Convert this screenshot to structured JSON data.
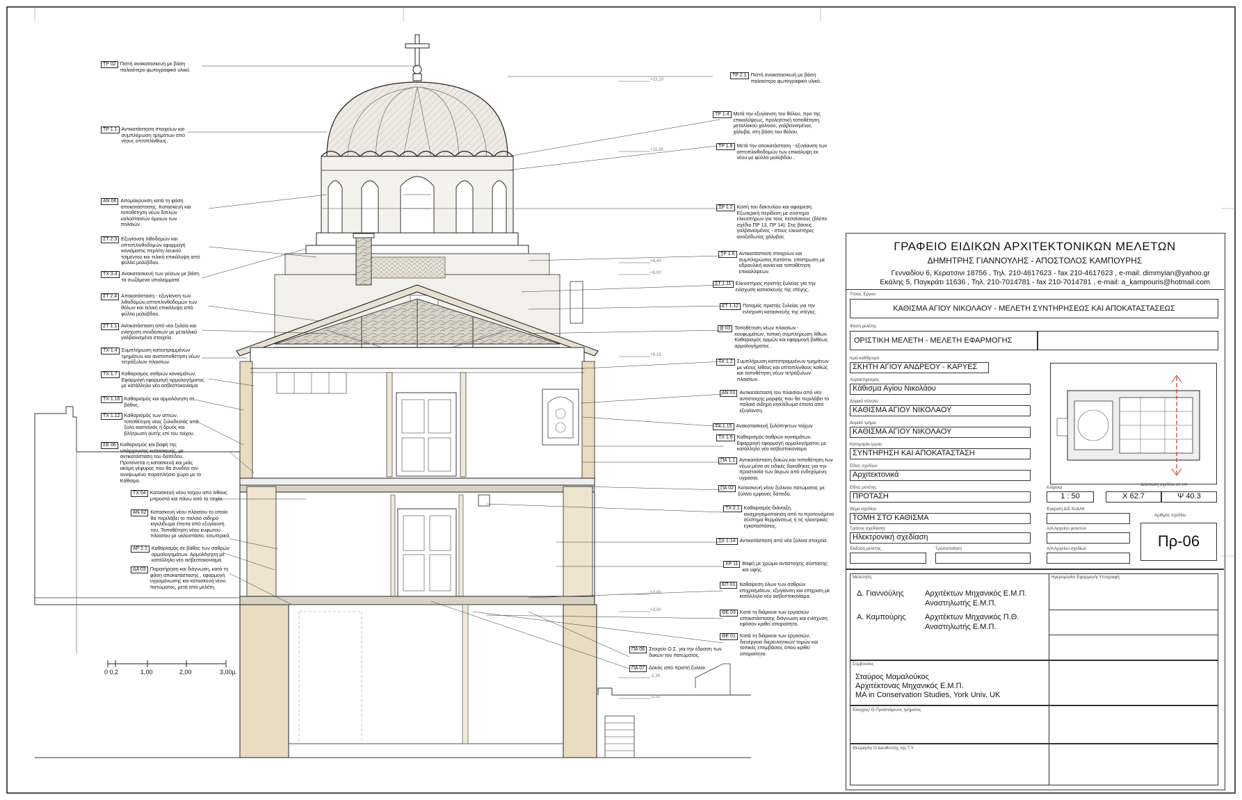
{
  "title_block": {
    "office": "ΓΡΑΦΕΙΟ ΕΙΔΙΚΩΝ ΑΡΧΙΤΕΚΤΟΝΙΚΩΝ ΜΕΛΕΤΩΝ",
    "architects": "ΔΗΜΗΤΡΗΣ ΓΙΑΝΝΟΥΛΗΣ  -  ΑΠΟΣΤΟΛΟΣ ΚΑΜΠΟΥΡΗΣ",
    "address1": "Γενναδίου 6, Κερατσινι 18756 , Τηλ. 210-4617623 - fax 210-4617623 , e-mail: dimmyian@yahoo.gr",
    "address2": "Εκάλης 5, Παγκράτι 11636 , Τηλ. 210-7014781 - fax 210-7014781 , e-mail: a_kampouris@hotmail.com",
    "lbl_project_title": "Τίτλος Έργου",
    "project_title": "ΚΑΘΙΣΜΑ ΑΓΙΟΥ ΝΙΚΟΛΑΟΥ - ΜΕΛΕΤΗ ΣΥΝΤΗΡΗΣΕΩΣ ΚΑΙ ΑΠΟΚΑΤΑΣΤΑΣΕΩΣ",
    "lbl_phase": "Φάση μελέτης",
    "phase": "ΟΡΙΣΤΙΚΗ ΜΕΛΕΤΗ - ΜΕΛΕΤΗ ΕΦΑΡΜΟΓΗΣ",
    "lbl_monastery": "Ιερά καθίδρυμα",
    "monastery": "ΣΚΗΤΗ ΑΓΙΟΥ ΑΝΔΡΕΟΥ - ΚΑΡΥΕΣ",
    "lbl_chrono": "Χαρακτηρισμός",
    "chrono": "Κάθισμα Αγίου Νικολάου",
    "lbl_complex": "Δομικό σύνολο",
    "complex": "ΚΑΘΙΣΜΑ ΑΓΙΟΥ ΝΙΚΟΛΑΟΥ",
    "lbl_part": "Δομικό τμήμα",
    "part": "ΚΑΘΙΣΜΑ ΑΓΙΟΥ ΝΙΚΟΛΑΟΥ",
    "lbl_category": "Κατηγορία έργου",
    "category": "ΣΥΝΤΗΡΗΣΗ ΚΑΙ ΑΠΟΚΑΤΑΣΤΑΣΗ",
    "lbl_type": "Είδος σχεδίων",
    "type": "Αρχιτεκτονικά",
    "lbl_study_type": "Είδος μελέτης",
    "study_type": "ΠΡΟΤΑΣΗ",
    "lbl_scale": "Κλίμακα",
    "scale": "1 : 50",
    "lbl_dims": "Διάσταση σχεδίου σε cm",
    "dim_x": "Χ 62.7",
    "dim_y": "Ψ 40.3",
    "lbl_subject": "Θέμα σχεδίου",
    "subject": "ΤΟΜΗ ΣΤΟ ΚΑΘΙΣΜΑ",
    "lbl_approval": "Έγκριση Δ/Σ ΚεΔΑΚ",
    "lbl_method": "Τρόπος σχεδίασης",
    "method": "Ηλεκτρονική σχεδίαση",
    "lbl_archive1": "Α/Α Αρχείου μελετών",
    "lbl_drawing_no": "Αριθμός σχεδίου",
    "drawing_no": "Πρ-06",
    "lbl_issue": "Έκδοση μελέτης",
    "lbl_revision": "Τροποποίηση",
    "lbl_archive2": "Α/Α Αρχείου σχεδίων",
    "lbl_designers": "Μελετητές",
    "lbl_date_sign": "Ημερομηνία/ Εφαρμογή/ Υπογραφή",
    "designer1_name": "Δ. Γιαννούλης",
    "designer1_role1": "Αρχιτέκτων Μηχανικός Ε.Μ.Π.",
    "designer1_role2": "Αναστηλωτής Ε.Μ.Π.",
    "designer2_name": "Α. Καμπούρης",
    "designer2_role1": "Αρχιτέκτων Μηχανικός Π.Θ.",
    "designer2_role2": "Αναστηλωτής Ε.Μ.Π.",
    "lbl_consultant": "Σύμβουλος",
    "consultant1": "Σταύρος  Μαμαλούκος",
    "consultant2": "Αρχιτέκτονας Μηχανικός Ε.Μ.Π.",
    "consultant3": "MA in Conservation Studies, York Univ. UK",
    "lbl_check": "Έλεγχος/ Ο Προϊστάμενος τμήματος",
    "lbl_approved": "Θεώρηση/ Ο Διευθυντής της Τ.Υ."
  },
  "scale_bar": {
    "labels": [
      "0 0,2",
      "1,00",
      "2,00",
      "3,00μ."
    ]
  },
  "levels": [
    "+13,10",
    "+11,39",
    "+8,40",
    "+8,00",
    "+6,15",
    "+3,00",
    "+2,00",
    "-2,20",
    "-3,10"
  ],
  "left_notes": [
    {
      "code": "ΤΡ 02",
      "text": "Πιστή ανακατασκευή με βάση παλαιότερο φωτογραφικό υλικό."
    },
    {
      "code": "ΤΡ 1.1",
      "text": "Αντικατάσταση στοιχείων και συμπλήρωση τμημάτων από νέους οπτοπλίνθους."
    },
    {
      "code": "ΑΝ 06",
      "text": "Απομάκρυνση κατά τη φάση αποκατάστασης. Κατασκευή και τοποθέτηση νέων διπλών υαλοστασίων όμοιων των παλαιών."
    },
    {
      "code": "ΣΤ 2.3",
      "text": "Εξυγίανση λιθοδομών και οπτοπλινθοδομών  εφαρμογή κονιάματος περλίτη-λευκού τσιμέντου και τελική επικάλυψη από φύλλα μολύβδου."
    },
    {
      "code": "ΤΧ 3.4",
      "text": "Ανακατασκευή των γείσων με βάση τα σωζόμενα υπολείμματα."
    },
    {
      "code": "ΣΤ 2.4",
      "text": "Αποκατάσταση - εξυγίανση των λιθοδομών,οπτοπλινθοδομών των θόλων και τελική επικάλυψη από φύλλα μολύβδου."
    },
    {
      "code": "ΣΤ 1.1",
      "text": "Αντικατάσταση από νέα ξυλεία και ενίσχυση συνδέσεων με μεταλλικά γαλβανισμένα στοιχεία."
    },
    {
      "code": "ΤΧ 1.4",
      "text": "Συμπλήρωση κατεστραμμένων τμημάτων και ανατοποθέτηση νέων τετράξυλων πλαισίων."
    },
    {
      "code": "ΤΧ 1.7",
      "text": "Καθαρισμός σαθρών κονιαμάτων. Εφαρμογή εφαρμογή αρμολογήματος με κατάλληλο νέο ασβεστοκονίαμα"
    },
    {
      "code": "ΤΧ 1.16",
      "text": "Καθαρισμός και αρμολόγηση σε βάθος."
    },
    {
      "code": "ΤΧ 1.12",
      "text": "Καθαρισμός των αττιών, τοποθέτηση νέας ξυλοδεσιάς από ξύλο καστανιάς ή δρυός και βλήτρωση αυτής επί του τοίχου."
    },
    {
      "code": "ΣΕ 06",
      "text": "Καθαρισμός και βαφή της υπάρχουσας κατασκευής, με αντικατάσταση του δαπέδου. Προτείνεται η κατασκευή και μιάς ακόμη γέφυρας που θα συνδέει τον ανυψωμένο παραπλήσιο χώρο με το Κάθισμα."
    },
    {
      "code": "ΤΧ 04",
      "text": "Κατασκευή νέου τοίχου από λίθους μπροστά και πάνω από το τοιχίο."
    },
    {
      "code": "ΑΝ 02",
      "text": "Κατασκευή νέου πλαισίου το οποίο θα περιλάβει το παλαιό σιδηρό κιγκλίδωμα έπειτα από εξυγίανσή του. Τοποθέτηση νέου κυφωτού πλαισίου με υαλοστάσιο, εσωτερικά."
    },
    {
      "code": "ΑΡ 1.1",
      "text": "Καθαρισμός σε βάθος των σαθρών αρμολογημάτων. Αρμολόγηση με κατάλληλο νέο ασβεστοκονίαμα."
    },
    {
      "code": "ΔΑ 03",
      "text": "Παρατήρηση και διάγνωση, κατά τη φάση αποκατάστασης , εφαρμογή υγρομόνωσης και κατασκευή νέου πατώματος, μετά από μελέτη."
    }
  ],
  "right_notes": [
    {
      "code": "ΤΡ 2.1",
      "text": "Πιστή ανακατασκευή με βάση παλαιότερο φωτογραφικό υλικό."
    },
    {
      "code": "ΤΡ 1.4",
      "text": "Μετά την εξυγίανση του θόλου, προ της επικαλύψεως, προληπτική τοποθέτηση μεταλλικού χαλινού, γαλβανισμένος χάλυβα, στη βάση του θόλου."
    },
    {
      "code": "ΤΡ 1.8",
      "text": "Μετά την αποκατάσταση - εξυγίανση των  οπτοπλινθοδομών των επικάλυψη εκ νέου με φύλλα μολύβδου ."
    },
    {
      "code": "ΤΡ 1.2",
      "text": "Κοπή του δακτυλίου και αφαίρεση. Εξωτερική περίδεση με σύστημα ελκυστήρων  για τους πεσσίσκους (βλέπε σχέδιο ΠΡ 13, ΠΡ 14). Στις βάσεις γαλβανισμένος - στους ελκυστήρες ανοξείδωτος χάλυβας"
    },
    {
      "code": "ΤΡ 1.6",
      "text": "Αντικατάσταση στοιχείων και συμπληρώσεις.Κατόπιν, επίστρωση με υδραυλική κονία και τοποθέτηση επικαλύψεων."
    },
    {
      "code": "ΣΤ 1.11",
      "text": "Ελκυστήρας πριστής ξυλείας για την ενίσχυση κατασκευής της στέγης."
    },
    {
      "code": "ΣΤ 1.12",
      "text": "Ποταμός πριστής ξυλείας για την ενίσχυση κατασκευής της στέγης."
    },
    {
      "code": "Θ 03",
      "text": "Τοποθέτηση νέων πλαισίων - κουφωμάτων, τοπική συμπλήρωση λίθων. Καθαρισμός αρμών και εφαρμογή βαθέως αρμολογήματος ."
    },
    {
      "code": "ΤΧ 1.2",
      "text": "Συμπλήρωση κατεστραμμένων τμημάτων με νέους λίθους και οπτοπλίνθους καθώς και τοποθέτηση νέων τετράξυλων πλαισίων."
    },
    {
      "code": "ΑΝ 01",
      "text": "Αντικατάσταση του πλαισίου από νέο αντίστοιχης μορφής που θα περιλάβει το παλαιό σιδηρό κιγκλίδωμα έπειτα από εξυγίανση."
    },
    {
      "code": "ΤΧ 1.15",
      "text": "Ανακατασκευή ξυλόπηκτων τοίχων"
    },
    {
      "code": "ΤΧ 1.6",
      "text": "Καθαρισμός σαθρών κονιαμάτων. Εφαρμογή εφαρμογή αρμολογήματος με κατάλληλο νέο ασβεστοκονίαμα"
    },
    {
      "code": "ΠΑ 1.1",
      "text": "Αντικατάσταση δοκών,και τοποθέτηση των νέων μέσα σε ειδικές δοκοθήκες για την προστασία των άκρων από ενδεχόμενη υγρασία."
    },
    {
      "code": "ΠΑ 02",
      "text": "Κατασκευή νέου ξύλινου πατώματος με ξύλινο εμφανές δάπεδο."
    },
    {
      "code": "ΤΧ 2.1",
      "text": "Καθαρισμός-διάνοιξη, αναχρησιμοποίηση από το προτεινόμενο σύστημα θερμάνσεως ή τις ηλεκτρικές  εγκαταστάσεις."
    },
    {
      "code": "ΤΧ 1.14",
      "text": "Αντικατάσταση από νέα ξύλινα στοιχεία."
    },
    {
      "code": "ΧΡ 11",
      "text": "Βαφή με χρώμα αντίστοιχης σύστασης και υφής."
    },
    {
      "code": "ΕΠ 01",
      "text": "Καθαίρεση όλων των  σαθρών επιχρισμάτων, εξυγίανση και επίχριση με κατάλληλο νέο ασβεστοκονίαμα."
    },
    {
      "code": "ΘΕ 03",
      "text": "Κατά τη διάρκεια των εργασιών αποκατάστασης διάγνωση και ενίσχυση εφόσον κριθεί απαραίτητο."
    },
    {
      "code": "ΘΕ 01",
      "text": "Κατά τη διάρκεια των εργασιών, διενέργεια διερευνητικών τομών και τοπικές επεμβάσεις όπου κριθεί απαραίτητο."
    },
    {
      "code": "ΠΑ 08",
      "text": "Στοιχείο Ο.Σ. για την έδραση των δοκών του πατώματος."
    },
    {
      "code": "ΠΑ 07",
      "text": "Δοκός από πριστή ξυλεία."
    }
  ]
}
